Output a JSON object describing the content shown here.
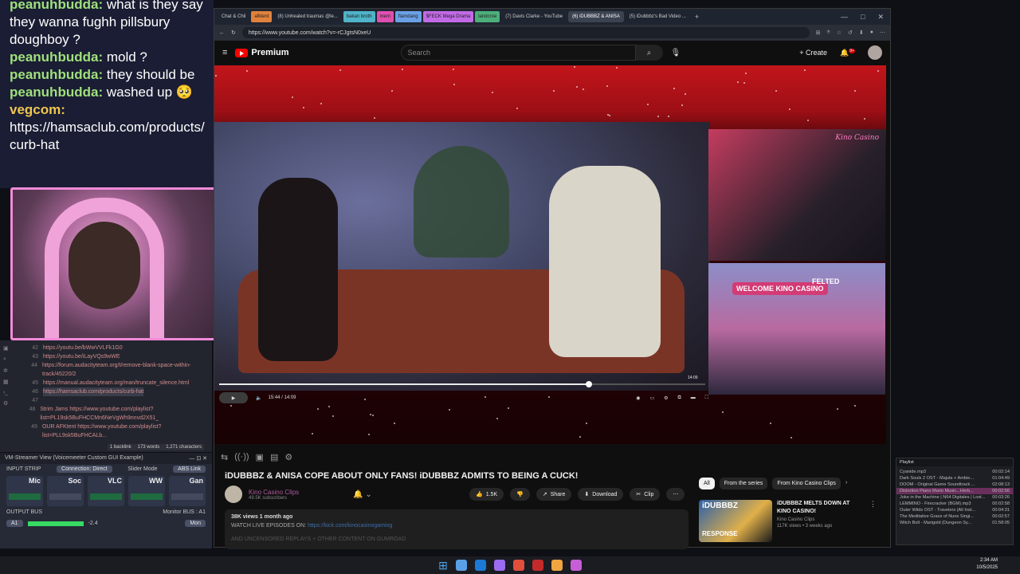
{
  "chat": {
    "lines": [
      {
        "user": "peanuhbudda:",
        "text": "what is they say they wanna fughh pillsbury doughboy ?",
        "color": "#9fe07c"
      },
      {
        "user": "peanuhbudda:",
        "text": "mold ?",
        "color": "#9fe07c"
      },
      {
        "user": "peanuhbudda:",
        "text": "they should be",
        "color": "#9fe07c"
      },
      {
        "user": "peanuhbudda:",
        "text": "washed up 🥺",
        "color": "#9fe07c"
      },
      {
        "user": "vegcom:",
        "text": "https://hamsaclub.com/products/curb-hat",
        "color": "#f0c64f"
      }
    ]
  },
  "editor": {
    "lines": [
      {
        "n": "42",
        "text": "https://youtu.be/bWwVVLFk1G0"
      },
      {
        "n": "43",
        "text": "https://youtu.be/iLayVQs9wWE"
      },
      {
        "n": "44",
        "text": "https://forum.audacityteam.org/t/remove-blank-space-within-track/45220/2"
      },
      {
        "n": "45",
        "text": "https://manual.audacityteam.org/man/truncate_silence.html"
      },
      {
        "n": "46",
        "text": "https://hamsaclub.com/products/curb-hat",
        "hl": true
      },
      {
        "n": "47",
        "text": ""
      },
      {
        "n": "48",
        "text": "Strim Jams https://www.youtube.com/playlist?list=PL19sk5BuFHCCMn6NeVgWh9nnvd2X51_"
      },
      {
        "n": "49",
        "text": "OUR AFKtent https://www.youtube.com/playlist?list=PLL9sk5BuFHCALb..."
      }
    ],
    "status": {
      "backlink": "1 backlink",
      "words": "173 words",
      "chars": "1,271 characters"
    }
  },
  "voicemeeter": {
    "title": "VM-Streamer View (Voicemeeter Custom GUI Example)",
    "input_strip": "INPUT STRIP",
    "connection": "Connection: Direct",
    "slider_mode_label": "Slider Mode",
    "slider_mode": "ABS Link",
    "strips": [
      "Mic",
      "Soc",
      "VLC",
      "WW",
      "Gan"
    ],
    "output_bus": "OUTPUT BUS",
    "monitor_bus": "Monitor BUS : A1",
    "bus_a1": "A1",
    "bus_level": "-2.4",
    "mon": "Mon"
  },
  "browser": {
    "tabs": [
      {
        "label": "Chat & Chil",
        "active": false
      },
      {
        "label": "afktent",
        "pill": "#e0823c"
      },
      {
        "label": "(8) Unhealed traumas @le...",
        "active": false
      },
      {
        "label": "bakan broth",
        "pill": "#4fb3c9"
      },
      {
        "label": "mem",
        "pill": "#e04fb0"
      },
      {
        "label": "flamdang",
        "pill": "#6aa0e6"
      },
      {
        "label": "$FECK Mega Drama",
        "pill": "#c26ae6"
      },
      {
        "label": "landcroe",
        "pill": "#4caf7a"
      },
      {
        "label": "(7) Davis Clarke - YouTube",
        "active": false
      },
      {
        "label": "(6) iDUBBBZ & ANISA",
        "active": true
      },
      {
        "label": "(5) iDubbbz's Bad Video ...",
        "active": false
      }
    ],
    "url": "https://www.youtube.com/watch?v=-rCJgtsN0xeU"
  },
  "youtube": {
    "logo": "Premium",
    "search_placeholder": "Search",
    "create": "+ Create",
    "notif_count": "9+",
    "cam1_tag": "Kino Casino",
    "welcome": "WELCOME KINO CASINO",
    "felted": "FELTED",
    "progress": 0.76,
    "time": "15:44 / 14:09",
    "thumb_time": "14:09",
    "title": "iDUBBBZ & ANISA COPE ABOUT ONLY FANS! iDUBBBZ ADMITS TO BEING A CUCK!",
    "channel": "Kino Casino Clips",
    "subs": "49.5K subscribers",
    "likes": "1.5K",
    "share": "Share",
    "download": "Download",
    "clip": "Clip",
    "views": "38K views  1 month ago",
    "live_prefix": "WATCH LIVE EPISODES ON:",
    "live_link": "https://kick.com/kinocasinogaming",
    "desc_cut": "AND UNCENSORED REPLAYS + OTHER CONTENT ON GUMROAD",
    "chips": [
      "All",
      "From the series",
      "From Kino Casino Clips"
    ],
    "rec": {
      "thumb_text": "iDUBBBZ",
      "thumb_bottom": "RESPONSE",
      "title": "iDUBBBZ MELTS DOWN AT KINO CASINO!",
      "channel": "Kino Casino Clips",
      "meta": "117K views • 3 weeks ago"
    }
  },
  "playlist": {
    "title": "Playlist",
    "items": [
      {
        "name": "Cyanide.mp3",
        "dur": "00:02:14"
      },
      {
        "name": "Dark Souls 2 OST - Majula + Ambie...",
        "dur": "01:04:49"
      },
      {
        "name": "DOOM - Original Game Soundtrack ...",
        "dur": "02:08:13"
      },
      {
        "name": "Distortion Piano Mario Music...Herb...",
        "dur": "00:02:56",
        "sel": true
      },
      {
        "name": "Joke in the Machine | N64 Digitales | Lost...",
        "dur": "00:03:26"
      },
      {
        "name": "LEMMINO - Firecracker (BGM).mp3",
        "dur": "00:02:58"
      },
      {
        "name": "Outer Wilds OST - Travelers (All Inst...",
        "dur": "00:04:31"
      },
      {
        "name": "The Meditative Grace of Nuns Singi...",
        "dur": "00:02:57"
      },
      {
        "name": "Witch Bolt - Marigold (Dungeon Sy...",
        "dur": "01:58:05"
      }
    ]
  },
  "taskbar": {
    "time": "2:34 AM",
    "date": "10/5/2025",
    "icons": [
      "#5aa0e6",
      "#1c7ad6",
      "#9b6cf0",
      "#e04f3c",
      "#c42a2a",
      "#f0a640",
      "#c65fd6"
    ]
  },
  "colors": {
    "accent": "#ff0000",
    "chat_user": "#9fe07c",
    "webcam_border": "#f28ad8"
  }
}
